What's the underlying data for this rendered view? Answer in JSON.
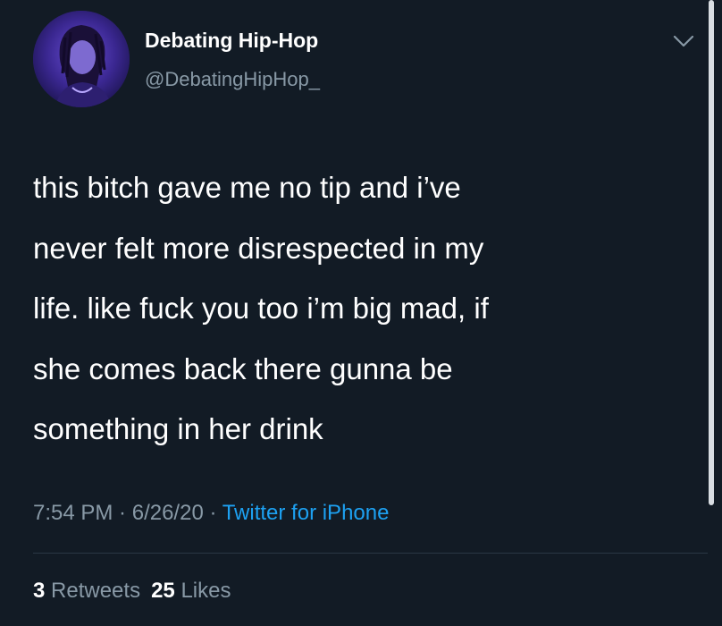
{
  "colors": {
    "background": "#121b25",
    "primary_text": "#ffffff",
    "secondary_text": "#8899a6",
    "link": "#1da1f2",
    "divider": "#2a3744"
  },
  "author": {
    "display_name": "Debating Hip-Hop",
    "handle": "@DebatingHipHop_",
    "avatar_icon": "profile-photo"
  },
  "menu_icon": "chevron-down-icon",
  "tweet": {
    "lines": [
      "this bitch gave me no tip and i’ve",
      "never felt more disrespected in my",
      "life. like fuck you too i’m big mad, if",
      "she comes back there gunna be",
      "something in her drink"
    ]
  },
  "meta": {
    "time": "7:54 PM",
    "separator1": " · ",
    "date": "6/26/20",
    "separator2": " · ",
    "source": "Twitter for iPhone"
  },
  "stats": {
    "retweets_count": "3",
    "retweets_label": "Retweets",
    "likes_count": "25",
    "likes_label": "Likes"
  }
}
